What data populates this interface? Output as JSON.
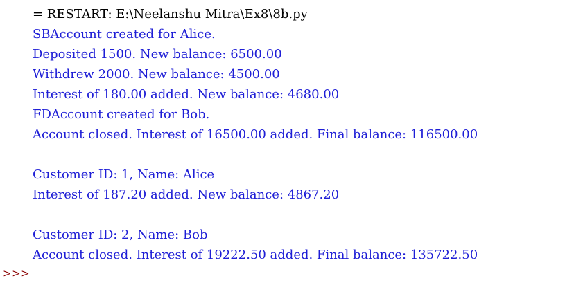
{
  "shell": {
    "restart_line": "= RESTART: E:\\Neelanshu Mitra\\Ex8\\8b.py",
    "output_lines": [
      "SBAccount created for Alice.",
      "Deposited 1500. New balance: 6500.00",
      "Withdrew 2000. New balance: 4500.00",
      "Interest of 180.00 added. New balance: 4680.00",
      "FDAccount created for Bob.",
      "Account closed. Interest of 16500.00 added. Final balance: 116500.00",
      "",
      "Customer ID: 1, Name: Alice",
      "Interest of 187.20 added. New balance: 4867.20",
      "",
      "Customer ID: 2, Name: Bob",
      "Account closed. Interest of 19222.50 added. Final balance: 135722.50"
    ],
    "prompt": ">>>"
  },
  "colors": {
    "output_text": "#1e1ed6",
    "restart_text": "#000000",
    "prompt_text": "#8b0000",
    "gutter_border": "#d9d9d9"
  }
}
